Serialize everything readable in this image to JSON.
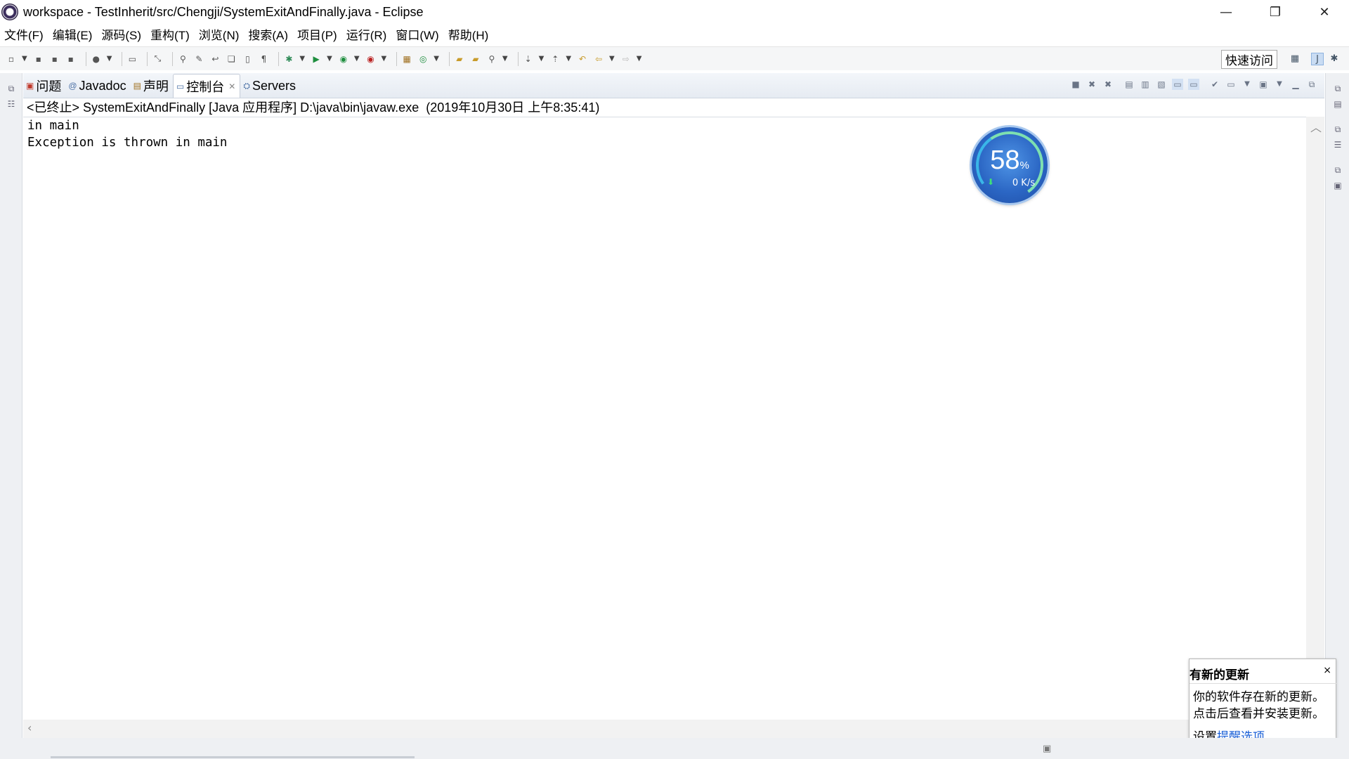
{
  "window": {
    "title": "workspace - TestInherit/src/Chengji/SystemExitAndFinally.java - Eclipse",
    "controls": {
      "minimize": "—",
      "restore": "❐",
      "close": "✕"
    }
  },
  "menu": [
    "文件(F)",
    "编辑(E)",
    "源码(S)",
    "重构(T)",
    "浏览(N)",
    "搜索(A)",
    "项目(P)",
    "运行(R)",
    "窗口(W)",
    "帮助(H)"
  ],
  "toolbar": {
    "quick_access_label": "快速访问"
  },
  "view": {
    "tabs": [
      {
        "label": "问题",
        "icon": "problems-icon"
      },
      {
        "label": "Javadoc",
        "icon": "javadoc-icon"
      },
      {
        "label": "声明",
        "icon": "declaration-icon"
      },
      {
        "label": "控制台",
        "icon": "console-icon",
        "active": true
      },
      {
        "label": "Servers",
        "icon": "servers-icon"
      }
    ],
    "console_header": "<已终止> SystemExitAndFinally [Java 应用程序] D:\\java\\bin\\javaw.exe  (2019年10月30日 上午8:35:41)",
    "console_lines": [
      "in main",
      "Exception is thrown in main"
    ]
  },
  "speed_widget": {
    "percent": "58",
    "percent_unit": "%",
    "rate": "0 K/s",
    "accent": "#2b66c4"
  },
  "notification": {
    "title": "有新的更新",
    "close": "×",
    "message": "你的软件存在新的更新。点击后查看并安装更新。",
    "footer_prefix": "设置",
    "footer_link": "提醒选项"
  }
}
